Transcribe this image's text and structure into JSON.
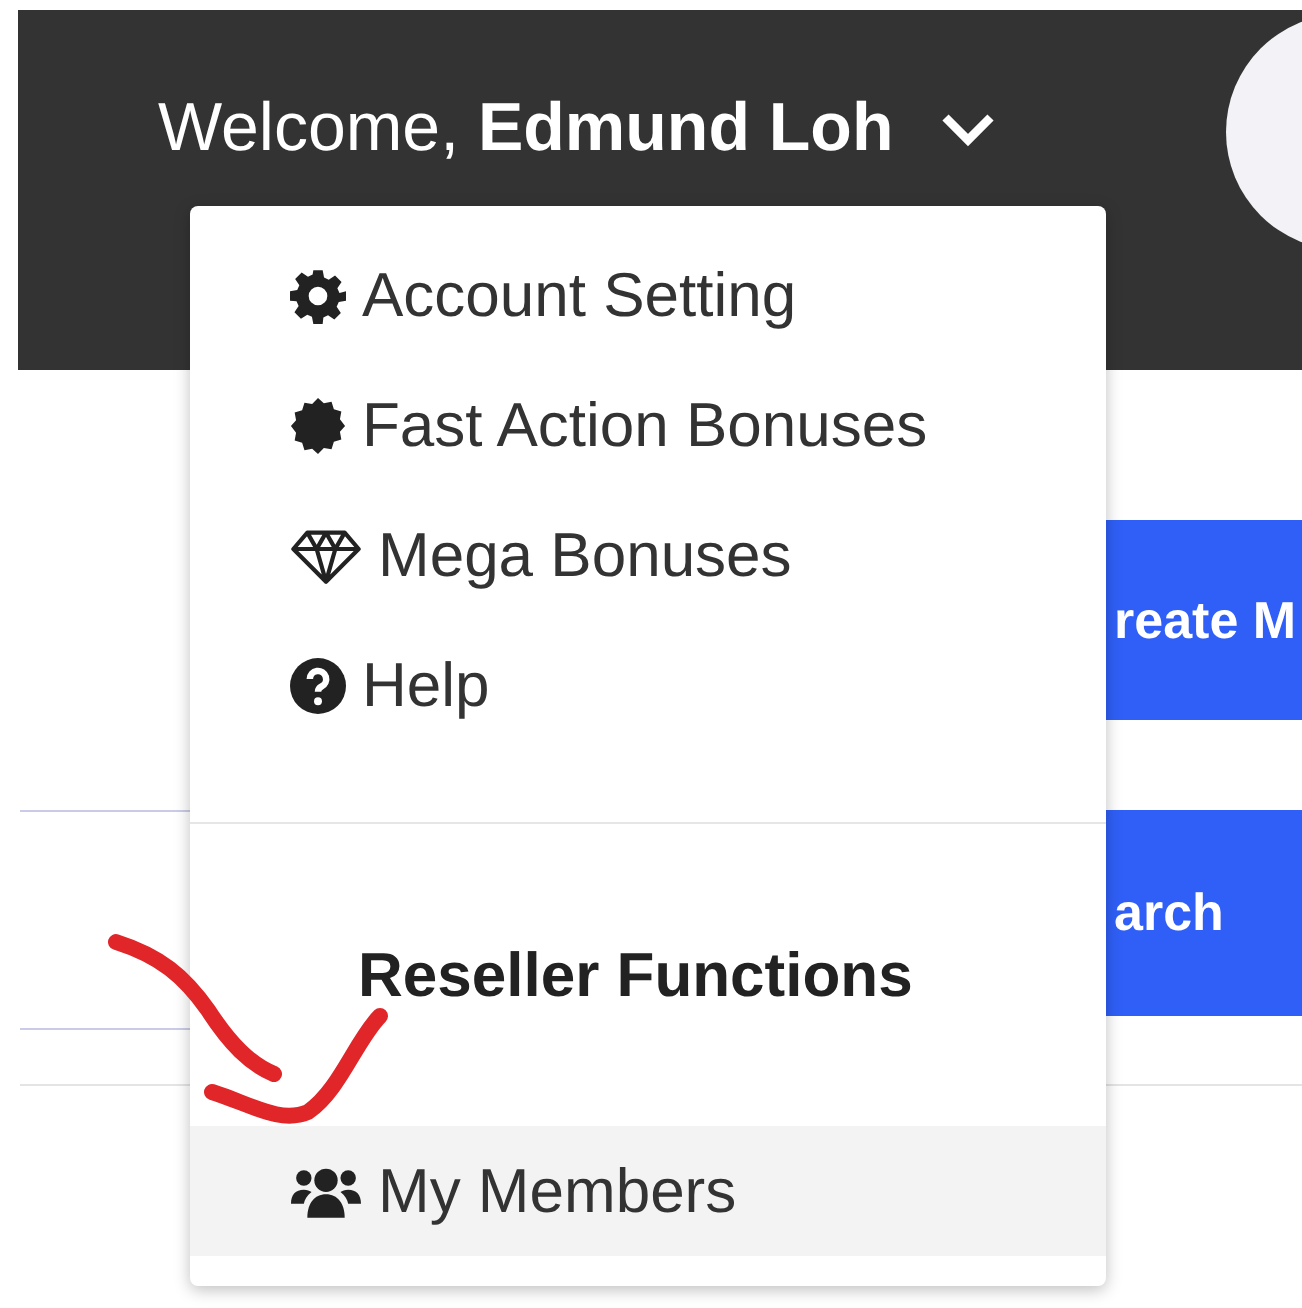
{
  "header": {
    "greeting": "Welcome, **Edmund Loh**"
  },
  "background_buttons": [
    {
      "label": "reate M"
    },
    {
      "label": "arch"
    }
  ],
  "dropdown": {
    "items": [
      {
        "label": "Account Setting",
        "kind": "gear",
        "selected": false
      },
      {
        "label": "Fast Action Bonuses",
        "kind": "seal",
        "selected": false
      },
      {
        "label": "Mega Bonuses",
        "kind": "diamond",
        "selected": false
      },
      {
        "label": "Help",
        "kind": "question",
        "selected": false
      }
    ],
    "section_title": "Reseller Functions",
    "section_items": [
      {
        "label": "My Members",
        "kind": "users",
        "selected": true
      }
    ]
  }
}
